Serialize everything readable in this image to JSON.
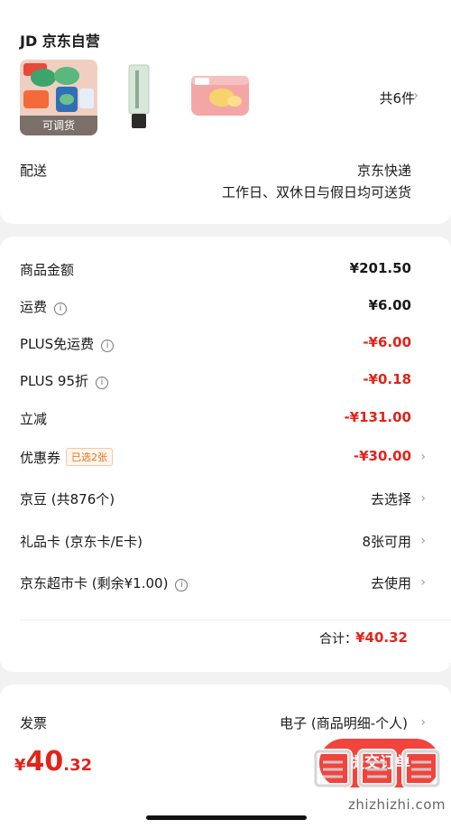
{
  "store": {
    "title": "JD 京东自营"
  },
  "items": {
    "tag": "可调货",
    "count_label": "共6件",
    "chevron": "›"
  },
  "delivery": {
    "label": "配送",
    "method": "京东快递",
    "note": "工作日、双休日与假日均可送货"
  },
  "price_rows": [
    {
      "label": "商品金额",
      "value": "¥201.50"
    },
    {
      "label": "运费",
      "value": "¥6.00",
      "info": "i"
    },
    {
      "label": "PLUS免运费",
      "value": "-¥6.00",
      "info": "i"
    },
    {
      "label": "PLUS 95折",
      "value": "-¥0.18",
      "info": "i"
    },
    {
      "label": "立减",
      "value": "-¥131.00"
    },
    {
      "label": "优惠券",
      "badge": "已选2张",
      "value": "-¥30.00"
    },
    {
      "label": "京豆 (共876个)",
      "value": "去选择"
    },
    {
      "label": "礼品卡 (京东卡/E卡)",
      "value": "8张可用"
    },
    {
      "label": "京东超市卡 (剩余¥1.00)",
      "value": "去使用",
      "info": "i"
    }
  ],
  "total": {
    "label": "合计：",
    "value": "¥40.32"
  },
  "invoice": {
    "label": "发票",
    "value": "电子 (商品明细-个人)"
  },
  "bottom": {
    "currency": "¥",
    "price_int": "40",
    "price_dec": ".32",
    "submit_label": "提交订单"
  },
  "watermark": {
    "text": "zhizhizhi.com",
    "logo": "值值值"
  },
  "colors": {
    "accent": "#e2231a",
    "button": "#f1443c"
  }
}
